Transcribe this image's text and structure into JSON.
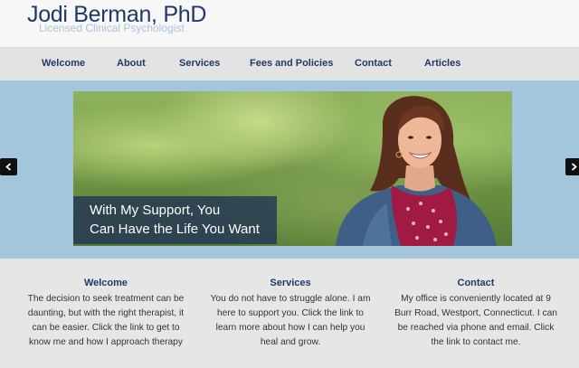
{
  "header": {
    "title": "Jodi Berman, PhD",
    "subtitle": "Licensed Clinical Psychologist"
  },
  "nav": {
    "items": [
      {
        "label": "Welcome"
      },
      {
        "label": "About"
      },
      {
        "label": "Services"
      },
      {
        "label": "Fees and Policies"
      },
      {
        "label": "Contact"
      },
      {
        "label": "Articles"
      }
    ]
  },
  "hero": {
    "caption_line1": "With My Support, You",
    "caption_line2": "Can Have the Life You Want",
    "prev_icon": "chevron-left-icon",
    "next_icon": "chevron-right-icon"
  },
  "features": [
    {
      "title": "Welcome",
      "text": "The decision to seek treatment can be daunting, but with the right therapist, it can be easier. Click the link to get to know me and how I approach therapy"
    },
    {
      "title": "Services",
      "text": "You do not have to struggle alone. I am here to support you. Click the link to learn more about how I can help you heal and grow."
    },
    {
      "title": "Contact",
      "text": "My office is conveniently located at 9 Burr Road, Westport, Connecticut. I can be reached via phone and email. Click the link to contact me."
    }
  ],
  "colors": {
    "brand": "#1f3a66",
    "hero_background": "#a3c6dd",
    "nav_background": "#e3e3e3"
  }
}
